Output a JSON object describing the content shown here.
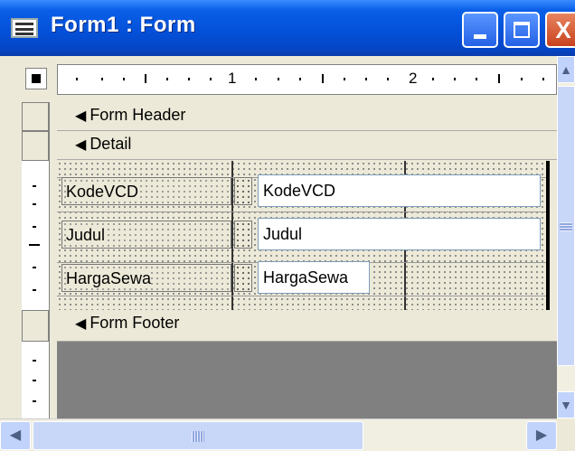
{
  "window": {
    "title": "Form1 : Form",
    "icon": "form-window-icon",
    "controls": {
      "minimize_icon": "minimize-icon",
      "maximize_icon": "maximize-icon",
      "close_icon": "close-icon",
      "close_glyph": "X"
    }
  },
  "ruler": {
    "numbers": [
      "1",
      "2"
    ]
  },
  "sections": {
    "form_header": "Form Header",
    "detail": "Detail",
    "form_footer": "Form Footer"
  },
  "controls": [
    {
      "label": "KodeVCD",
      "textbox": "KodeVCD"
    },
    {
      "label": "Judul",
      "textbox": "Judul"
    },
    {
      "label": "HargaSewa",
      "textbox": "HargaSewa"
    }
  ],
  "scrollbars": {
    "up_glyph": "▲",
    "down_glyph": "▼",
    "left_glyph": "◀",
    "right_glyph": "▶"
  },
  "colors": {
    "titlebar": "#0451D9",
    "face": "#ECE9D8",
    "footer_fill": "#808080",
    "textbox_border": "#7F9DB9"
  }
}
